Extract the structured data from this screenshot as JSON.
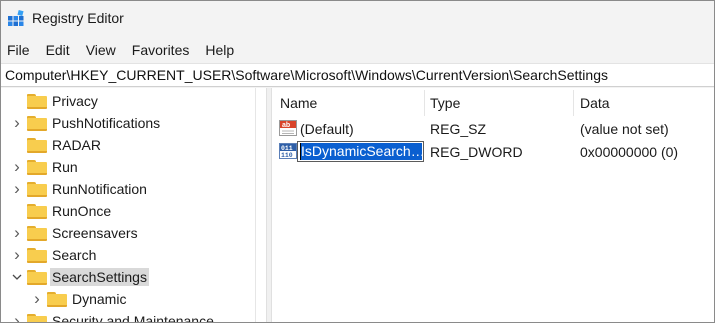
{
  "window": {
    "title": "Registry Editor",
    "icon": "registry-editor-icon",
    "accent": "#0a5fd0"
  },
  "menu": [
    "File",
    "Edit",
    "View",
    "Favorites",
    "Help"
  ],
  "address": "Computer\\HKEY_CURRENT_USER\\Software\\Microsoft\\Windows\\CurrentVersion\\SearchSettings",
  "tree": [
    {
      "label": "Privacy",
      "expander": "",
      "indent": 0,
      "selected": false
    },
    {
      "label": "PushNotifications",
      "expander": ">",
      "indent": 0,
      "selected": false
    },
    {
      "label": "RADAR",
      "expander": "",
      "indent": 0,
      "selected": false
    },
    {
      "label": "Run",
      "expander": ">",
      "indent": 0,
      "selected": false
    },
    {
      "label": "RunNotification",
      "expander": ">",
      "indent": 0,
      "selected": false
    },
    {
      "label": "RunOnce",
      "expander": "",
      "indent": 0,
      "selected": false
    },
    {
      "label": "Screensavers",
      "expander": ">",
      "indent": 0,
      "selected": false
    },
    {
      "label": "Search",
      "expander": ">",
      "indent": 0,
      "selected": false
    },
    {
      "label": "SearchSettings",
      "expander": "v",
      "indent": 0,
      "selected": true
    },
    {
      "label": "Dynamic",
      "expander": ">",
      "indent": 1,
      "selected": false
    },
    {
      "label": "Security and Maintenance",
      "expander": ">",
      "indent": 0,
      "selected": false
    }
  ],
  "list": {
    "columns": [
      "Name",
      "Type",
      "Data"
    ],
    "rows": [
      {
        "name": "(Default)",
        "type": "REG_SZ",
        "data": "(value not set)",
        "icon": "string-value-icon",
        "editing": false
      },
      {
        "name": "IsDynamicSearch…",
        "type": "REG_DWORD",
        "data": "0x00000000 (0)",
        "icon": "binary-value-icon",
        "editing": true
      }
    ]
  }
}
